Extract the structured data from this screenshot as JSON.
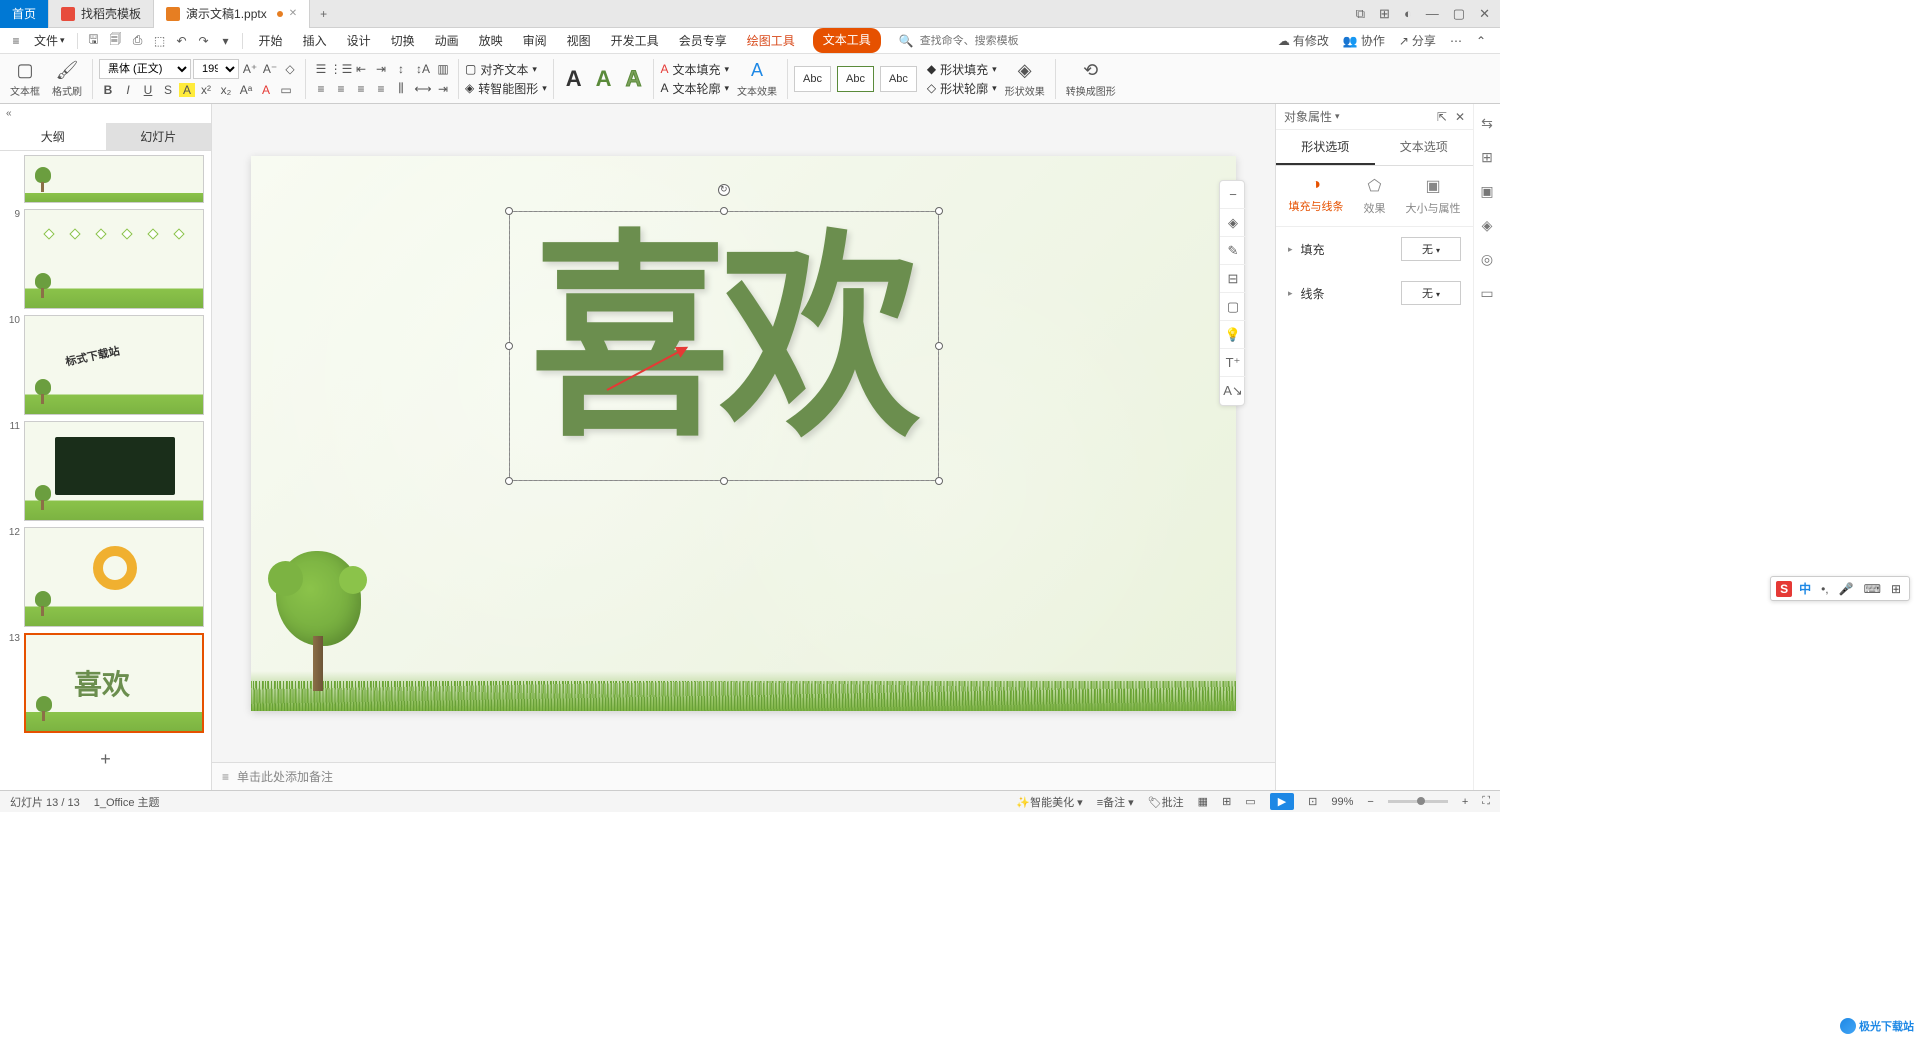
{
  "titlebar": {
    "home_tab": "首页",
    "tab1": "找稻壳模板",
    "tab2": "演示文稿1.pptx"
  },
  "menubar": {
    "file": "文件",
    "tabs": [
      "开始",
      "插入",
      "设计",
      "切换",
      "动画",
      "放映",
      "审阅",
      "视图",
      "开发工具",
      "会员专享"
    ],
    "draw_tool": "绘图工具",
    "text_tool": "文本工具",
    "search_placeholder": "查找命令、搜索模板",
    "pending": "有修改",
    "coop": "协作",
    "share": "分享"
  },
  "ribbon": {
    "textbox": "文本框",
    "format_painter": "格式刷",
    "font_name": "黑体 (正文)",
    "font_size": "199",
    "align_text": "对齐文本",
    "smart_shape": "转智能图形",
    "text_fill": "文本填充",
    "text_outline": "文本轮廓",
    "text_effect": "文本效果",
    "abc": "Abc",
    "shape_fill": "形状填充",
    "shape_outline": "形状轮廓",
    "shape_effect": "形状效果",
    "convert_img": "转换成图形"
  },
  "thumbs": {
    "outline": "大纲",
    "slides": "幻灯片",
    "th10_text": "标式下载站",
    "th13_text": "喜欢",
    "nums": [
      "9",
      "10",
      "11",
      "12",
      "13"
    ]
  },
  "slide": {
    "big_text": "喜欢",
    "notes_placeholder": "单击此处添加备注"
  },
  "panel": {
    "title": "对象属性",
    "tab1": "形状选项",
    "tab2": "文本选项",
    "fill_line": "填充与线条",
    "effect": "效果",
    "size_prop": "大小与属性",
    "fill": "填充",
    "line": "线条",
    "none": "无"
  },
  "status": {
    "slide_pos": "幻灯片 13 / 13",
    "theme": "1_Office 主题",
    "beautify": "智能美化",
    "notes": "备注",
    "annotate": "批注",
    "zoom": "99%"
  },
  "ime": {
    "s": "S",
    "zhong": "中",
    "keys": [
      "⌨",
      "🎤",
      "📋",
      "⊞"
    ]
  },
  "watermark": "极光下载站"
}
